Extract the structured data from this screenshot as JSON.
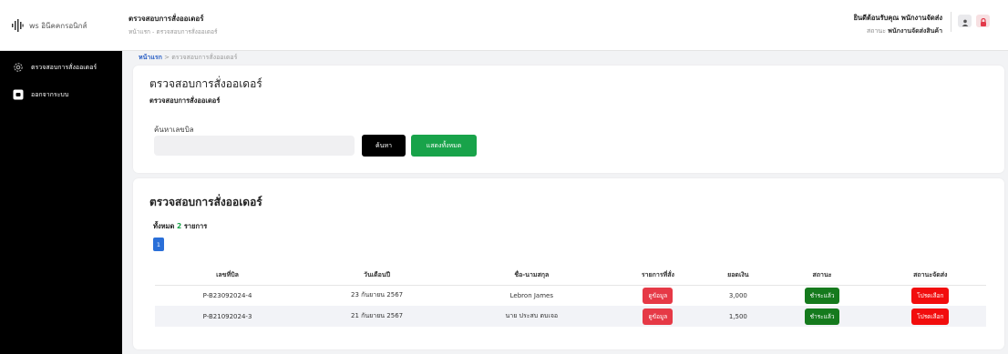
{
  "colors": {
    "sidebar_bg": "#000000",
    "accent_green": "#18a34a",
    "paid_green": "#157a1d",
    "detail_red": "#e63946",
    "ship_red": "#f20d0d",
    "link_blue": "#2a5fc4",
    "page_blue": "#2a6fd8"
  },
  "brand": {
    "name": "ws อินีคคกรอนิกส์",
    "icon": "waveform-logo-icon"
  },
  "header": {
    "title": "ตรวจสอบการสั่งออเดอร์",
    "breadcrumb": "หน้าแรก - ตรวจสอบการสั่งออเดอร์"
  },
  "user": {
    "greeting": "ยินดีต้อนรับคุณ พนักงานจัดส่ง",
    "status_label": "สถานะ",
    "role": "พนักงานจัดส่งสินค้า",
    "icons": [
      "user-icon",
      "lock-icon"
    ]
  },
  "sidebar": {
    "items": [
      {
        "label": "ตรวจสอบการสั่งออเดอร์",
        "icon": "gear-icon"
      },
      {
        "label": "ออกจากระบบ",
        "icon": "logout-icon"
      }
    ]
  },
  "breadcrumb": {
    "home": "หน้าแรก",
    "separator": ">",
    "current": "ตรวจสอบการสั่งออเดอร์"
  },
  "search_card": {
    "title": "ตรวจสอบการสั่งออเดอร์",
    "subtitle": "ตรวจสอบการสั่งออเดอร์",
    "search_label": "ค้นหาเลขบิล",
    "search_value": "",
    "search_button": "ค้นหา",
    "show_all_button": "แสดงทั้งหมด"
  },
  "orders_card": {
    "title": "ตรวจสอบการสั่งออเดอร์",
    "total_prefix": "ทั้งหมด",
    "total_count": "2",
    "total_suffix": "รายการ",
    "current_page": "1",
    "columns": [
      "เลขที่บิล",
      "วันเดือนปี",
      "ชื่อ-นามสกุล",
      "รายการที่สั่ง",
      "ยอดเงิน",
      "สถานะ",
      "สถานะจัดส่ง"
    ],
    "rows": [
      {
        "bill_no": "P-B23092024-4",
        "date": "23 กันยายน 2567",
        "name": "Lebron James",
        "items_btn": "ดูข้อมูล",
        "amount": "3,000",
        "status": "ชำระแล้ว",
        "ship_status": "โปรดเลือก"
      },
      {
        "bill_no": "P-B21092024-3",
        "date": "21 กันยายน 2567",
        "name": "นาย ประสบ ตบเจอ",
        "items_btn": "ดูข้อมูล",
        "amount": "1,500",
        "status": "ชำระแล้ว",
        "ship_status": "โปรดเลือก"
      }
    ]
  }
}
